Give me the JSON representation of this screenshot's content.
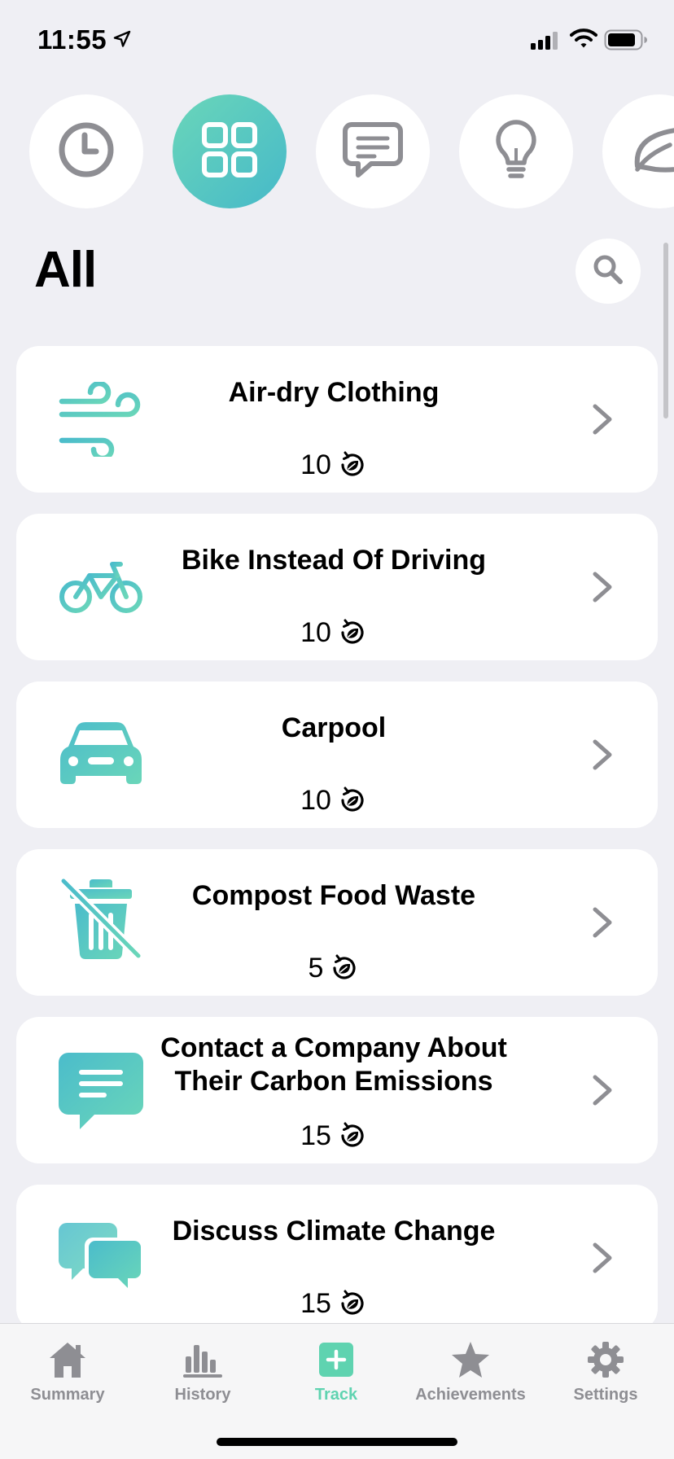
{
  "status_bar": {
    "time": "11:55"
  },
  "colors": {
    "accent": "#5fd3b0",
    "accent_gradient_end": "#46b9c9",
    "inactive": "#8e8e93",
    "background": "#efeff4"
  },
  "categories": [
    {
      "icon": "clock-icon",
      "active": false
    },
    {
      "icon": "grid-icon",
      "active": true
    },
    {
      "icon": "message-icon",
      "active": false
    },
    {
      "icon": "lightbulb-icon",
      "active": false
    },
    {
      "icon": "leaf-icon",
      "active": false
    }
  ],
  "page": {
    "title": "All"
  },
  "actions": [
    {
      "title": "Air-dry Clothing",
      "points": "10",
      "icon": "wind-icon"
    },
    {
      "title": "Bike Instead Of Driving",
      "points": "10",
      "icon": "bicycle-icon"
    },
    {
      "title": "Carpool",
      "points": "10",
      "icon": "car-icon"
    },
    {
      "title": "Compost Food Waste",
      "points": "5",
      "icon": "trash-slash-icon"
    },
    {
      "title": "Contact a Company About Their Carbon Emissions",
      "points": "15",
      "icon": "message-icon"
    },
    {
      "title": "Discuss Climate Change",
      "points": "15",
      "icon": "conversation-icon"
    }
  ],
  "tab_bar": {
    "tabs": [
      {
        "label": "Summary",
        "icon": "home-icon",
        "active": false
      },
      {
        "label": "History",
        "icon": "bar-chart-icon",
        "active": false
      },
      {
        "label": "Track",
        "icon": "plus-square-icon",
        "active": true
      },
      {
        "label": "Achievements",
        "icon": "star-icon",
        "active": false
      },
      {
        "label": "Settings",
        "icon": "gear-icon",
        "active": false
      }
    ]
  }
}
